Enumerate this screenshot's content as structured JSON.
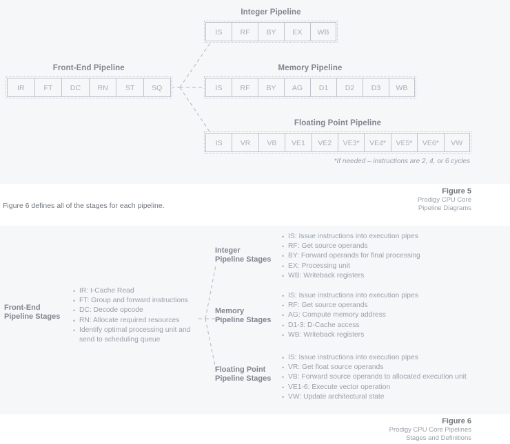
{
  "colors": {
    "panel_bg": "#f5f7f9",
    "page_bg": "#ffffff",
    "heading": "#80858e",
    "body_text": "#9ba1a9",
    "cell_border": "#bfc5cd"
  },
  "figure5": {
    "pipelines": [
      {
        "id": "front-end",
        "title": "Front-End Pipeline",
        "stages": [
          "IR",
          "FT",
          "DC",
          "RN",
          "ST",
          "SQ"
        ]
      },
      {
        "id": "integer",
        "title": "Integer Pipeline",
        "stages": [
          "IS",
          "RF",
          "BY",
          "EX",
          "WB"
        ]
      },
      {
        "id": "memory",
        "title": "Memory Pipeline",
        "stages": [
          "IS",
          "RF",
          "BY",
          "AG",
          "D1",
          "D2",
          "D3",
          "WB"
        ]
      },
      {
        "id": "float",
        "title": "Floating Point Pipeline",
        "stages": [
          "IS",
          "VR",
          "VB",
          "VE1",
          "VE2",
          "VE3*",
          "VE4*",
          "VE5*",
          "VE6*",
          "VW"
        ]
      }
    ],
    "footnote": "*If needed – instructions are 2, 4, or 6 cycles",
    "caption": {
      "title": "Figure 5",
      "lines": [
        "Prodigy CPU Core",
        "Pipeline Diagrams"
      ]
    }
  },
  "body_note": "Figure 6 defines all of the stages for each pipeline.",
  "figure6": {
    "front_end": {
      "label_line1": "Front-End",
      "label_line2": "Pipeline Stages",
      "bullets": [
        "IR:  I-Cache Read",
        "FT:  Group and forward instructions",
        "DC:  Decode opcode",
        "RN:  Allocate required resources",
        "Identify optimal processing unit and send to scheduling queue"
      ]
    },
    "integer": {
      "label_line1": "Integer",
      "label_line2": "Pipeline Stages",
      "bullets": [
        "IS:  Issue instructions into execution pipes",
        "RF:  Get source operands",
        "BY:  Forward operands for final processing",
        "EX:  Processing unit",
        "WB:  Writeback registers"
      ]
    },
    "memory": {
      "label_line1": "Memory",
      "label_line2": "Pipeline Stages",
      "bullets": [
        "IS:  Issue instructions into execution pipes",
        "RF:  Get source operands",
        "AG:  Compute memory address",
        "D1-3:  D-Cache access",
        "WB:  Writeback registers"
      ]
    },
    "floating_point": {
      "label_line1": "Floating Point",
      "label_line2": "Pipeline Stages",
      "bullets": [
        "IS:  Issue instructions into execution pipes",
        "VR:  Get float source operands",
        "VB:  Forward source operands to allocated execution unit",
        "VE1-6:  Execute vector operation",
        "VW:  Update architectural state"
      ]
    },
    "caption": {
      "title": "Figure 6",
      "lines": [
        "Prodigy CPU Core Pipelines",
        "Stages and Definitions"
      ]
    }
  }
}
